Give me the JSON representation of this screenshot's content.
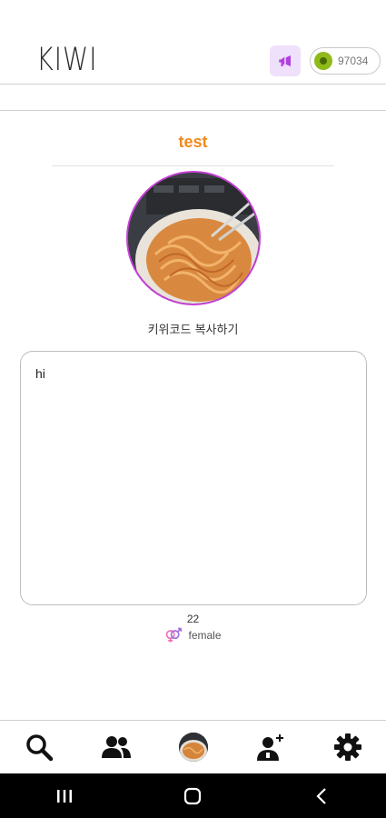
{
  "header": {
    "app_title": "KIWI",
    "coin_balance": "97034",
    "accent_color": "#efe0fb",
    "coin_color": "#8fba1a"
  },
  "profile": {
    "name": "test",
    "name_color": "#f08a1c",
    "ring_color": "#c63fd6",
    "copy_code_label": "키위코드 복사하기",
    "bio": "hi",
    "age": "22",
    "gender": "female"
  },
  "bottom_nav": {
    "items": [
      "search-icon",
      "friends-icon",
      "my-profile-avatar",
      "add-friend-icon",
      "settings-icon"
    ]
  },
  "system_nav": {
    "items": [
      "recent-apps-icon",
      "home-icon",
      "back-icon"
    ]
  }
}
